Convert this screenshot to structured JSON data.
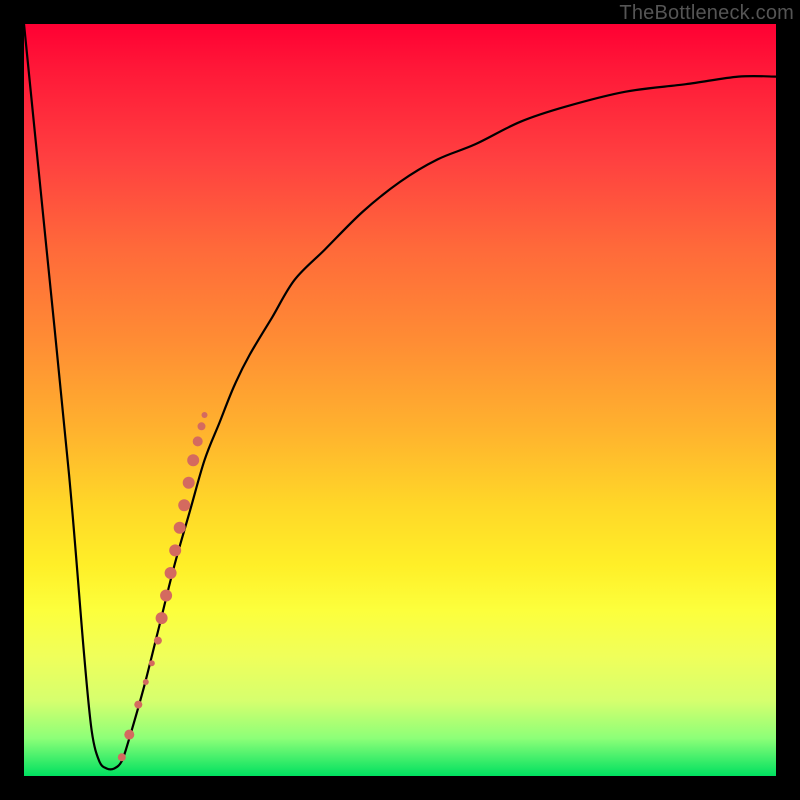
{
  "watermark": "TheBottleneck.com",
  "colors": {
    "frame": "#000000",
    "curve": "#000000",
    "dot": "#D46A5F",
    "gradient_top": "#ff0033",
    "gradient_bottom": "#00e060"
  },
  "chart_data": {
    "type": "line",
    "title": "",
    "xlabel": "",
    "ylabel": "",
    "xlim": [
      0,
      100
    ],
    "ylim": [
      0,
      100
    ],
    "note": "No axes or tick labels are rendered; values are read as percentages of the plot area width/height. y=0 is the top edge, y=100 the bottom.",
    "series": [
      {
        "name": "bottleneck-curve",
        "x": [
          0,
          3,
          6,
          8,
          9,
          10,
          11,
          12,
          13,
          14,
          16,
          18,
          20,
          22,
          24,
          26,
          28,
          30,
          33,
          36,
          40,
          45,
          50,
          55,
          60,
          66,
          72,
          80,
          88,
          95,
          100
        ],
        "y": [
          0,
          30,
          60,
          84,
          94,
          98,
          99,
          99,
          98,
          95,
          88,
          80,
          72,
          65,
          58,
          53,
          48,
          44,
          39,
          34,
          30,
          25,
          21,
          18,
          16,
          13,
          11,
          9,
          8,
          7,
          7
        ]
      }
    ],
    "marker_cluster": {
      "name": "highlighted-points",
      "note": "salmon dots along the right ascending flank of the V",
      "points": [
        {
          "x": 13.0,
          "y": 97.5,
          "r": 4
        },
        {
          "x": 14.0,
          "y": 94.5,
          "r": 5
        },
        {
          "x": 15.2,
          "y": 90.5,
          "r": 4
        },
        {
          "x": 16.2,
          "y": 87.5,
          "r": 3
        },
        {
          "x": 17.0,
          "y": 85.0,
          "r": 3
        },
        {
          "x": 17.8,
          "y": 82.0,
          "r": 4
        },
        {
          "x": 18.3,
          "y": 79.0,
          "r": 6
        },
        {
          "x": 18.9,
          "y": 76.0,
          "r": 6
        },
        {
          "x": 19.5,
          "y": 73.0,
          "r": 6
        },
        {
          "x": 20.1,
          "y": 70.0,
          "r": 6
        },
        {
          "x": 20.7,
          "y": 67.0,
          "r": 6
        },
        {
          "x": 21.3,
          "y": 64.0,
          "r": 6
        },
        {
          "x": 21.9,
          "y": 61.0,
          "r": 6
        },
        {
          "x": 22.5,
          "y": 58.0,
          "r": 6
        },
        {
          "x": 23.1,
          "y": 55.5,
          "r": 5
        },
        {
          "x": 23.6,
          "y": 53.5,
          "r": 4
        },
        {
          "x": 24.0,
          "y": 52.0,
          "r": 3
        }
      ]
    }
  }
}
